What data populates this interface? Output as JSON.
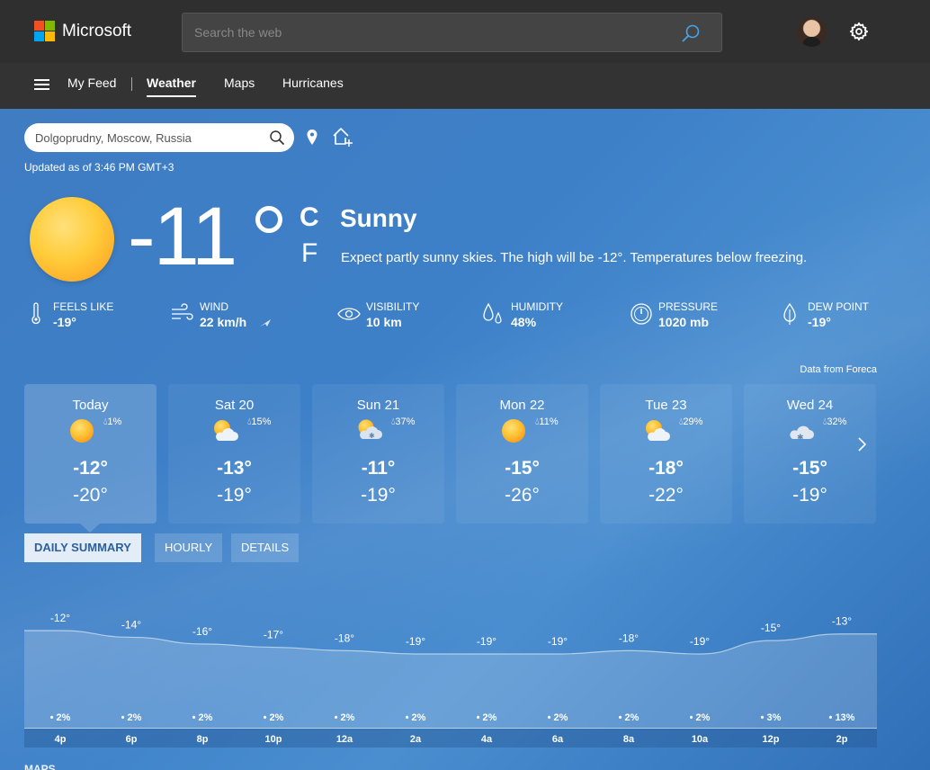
{
  "header": {
    "brand": "Microsoft",
    "brand_colors": [
      "#f25022",
      "#7fba00",
      "#00a4ef",
      "#ffb900"
    ],
    "search_placeholder": "Search the web",
    "search_icon": "search-icon",
    "settings_icon": "gear-icon"
  },
  "nav": {
    "items": [
      {
        "label": "My Feed",
        "active": false
      },
      {
        "label": "Weather",
        "active": true
      },
      {
        "label": "Maps",
        "active": false
      },
      {
        "label": "Hurricanes",
        "active": false
      }
    ]
  },
  "location": {
    "placeholder": "Dolgoprudny, Moscow, Russia",
    "updated": "Updated as of 3:46 PM GMT+3"
  },
  "current": {
    "temperature": "-11",
    "unit_c": "C",
    "unit_f": "F",
    "condition": "Sunny",
    "description": "Expect partly sunny skies. The high will be -12°. Temperatures below freezing."
  },
  "metrics": [
    {
      "label": "FEELS LIKE",
      "value": "-19°",
      "icon": "thermometer-icon"
    },
    {
      "label": "WIND",
      "value": "22 km/h",
      "icon": "wind-icon"
    },
    {
      "label": "VISIBILITY",
      "value": "10 km",
      "icon": "eye-icon"
    },
    {
      "label": "HUMIDITY",
      "value": "48%",
      "icon": "humidity-icon"
    },
    {
      "label": "PRESSURE",
      "value": "1020 mb",
      "icon": "gauge-icon"
    },
    {
      "label": "DEW POINT",
      "value": "-19°",
      "icon": "dew-point-icon"
    }
  ],
  "data_source": "Data from Foreca",
  "forecast": [
    {
      "day": "Today",
      "icon": "sun",
      "precip": "1%",
      "high": "-12°",
      "low": "-20°"
    },
    {
      "day": "Sat 20",
      "icon": "partly-sunny",
      "precip": "15%",
      "high": "-13°",
      "low": "-19°"
    },
    {
      "day": "Sun 21",
      "icon": "sun-snow",
      "precip": "37%",
      "high": "-11°",
      "low": "-19°"
    },
    {
      "day": "Mon 22",
      "icon": "sun",
      "precip": "11%",
      "high": "-15°",
      "low": "-26°"
    },
    {
      "day": "Tue 23",
      "icon": "partly-sunny",
      "precip": "29%",
      "high": "-18°",
      "low": "-22°"
    },
    {
      "day": "Wed 24",
      "icon": "snow-cloud",
      "precip": "32%",
      "high": "-15°",
      "low": "-19°"
    }
  ],
  "tabs": [
    {
      "label": "DAILY SUMMARY",
      "active": true
    },
    {
      "label": "HOURLY",
      "active": false
    },
    {
      "label": "DETAILS",
      "active": false
    }
  ],
  "hourly": {
    "times": [
      "4p",
      "6p",
      "8p",
      "10p",
      "12a",
      "2a",
      "4a",
      "6a",
      "8a",
      "10a",
      "12p",
      "2p"
    ],
    "temps": [
      -12,
      -14,
      -16,
      -17,
      -18,
      -19,
      -19,
      -19,
      -18,
      -19,
      -15,
      -13
    ],
    "temp_labels": [
      "-12°",
      "-14°",
      "-16°",
      "-17°",
      "-18°",
      "-19°",
      "-19°",
      "-19°",
      "-18°",
      "-19°",
      "-15°",
      "-13°"
    ],
    "precip": [
      "2%",
      "2%",
      "2%",
      "2%",
      "2%",
      "2%",
      "2%",
      "2%",
      "2%",
      "2%",
      "3%",
      "13%"
    ]
  },
  "section_cutoff": "MAPS",
  "colors": {
    "accent": "#2f73bd",
    "sun": "#ffb02e"
  }
}
